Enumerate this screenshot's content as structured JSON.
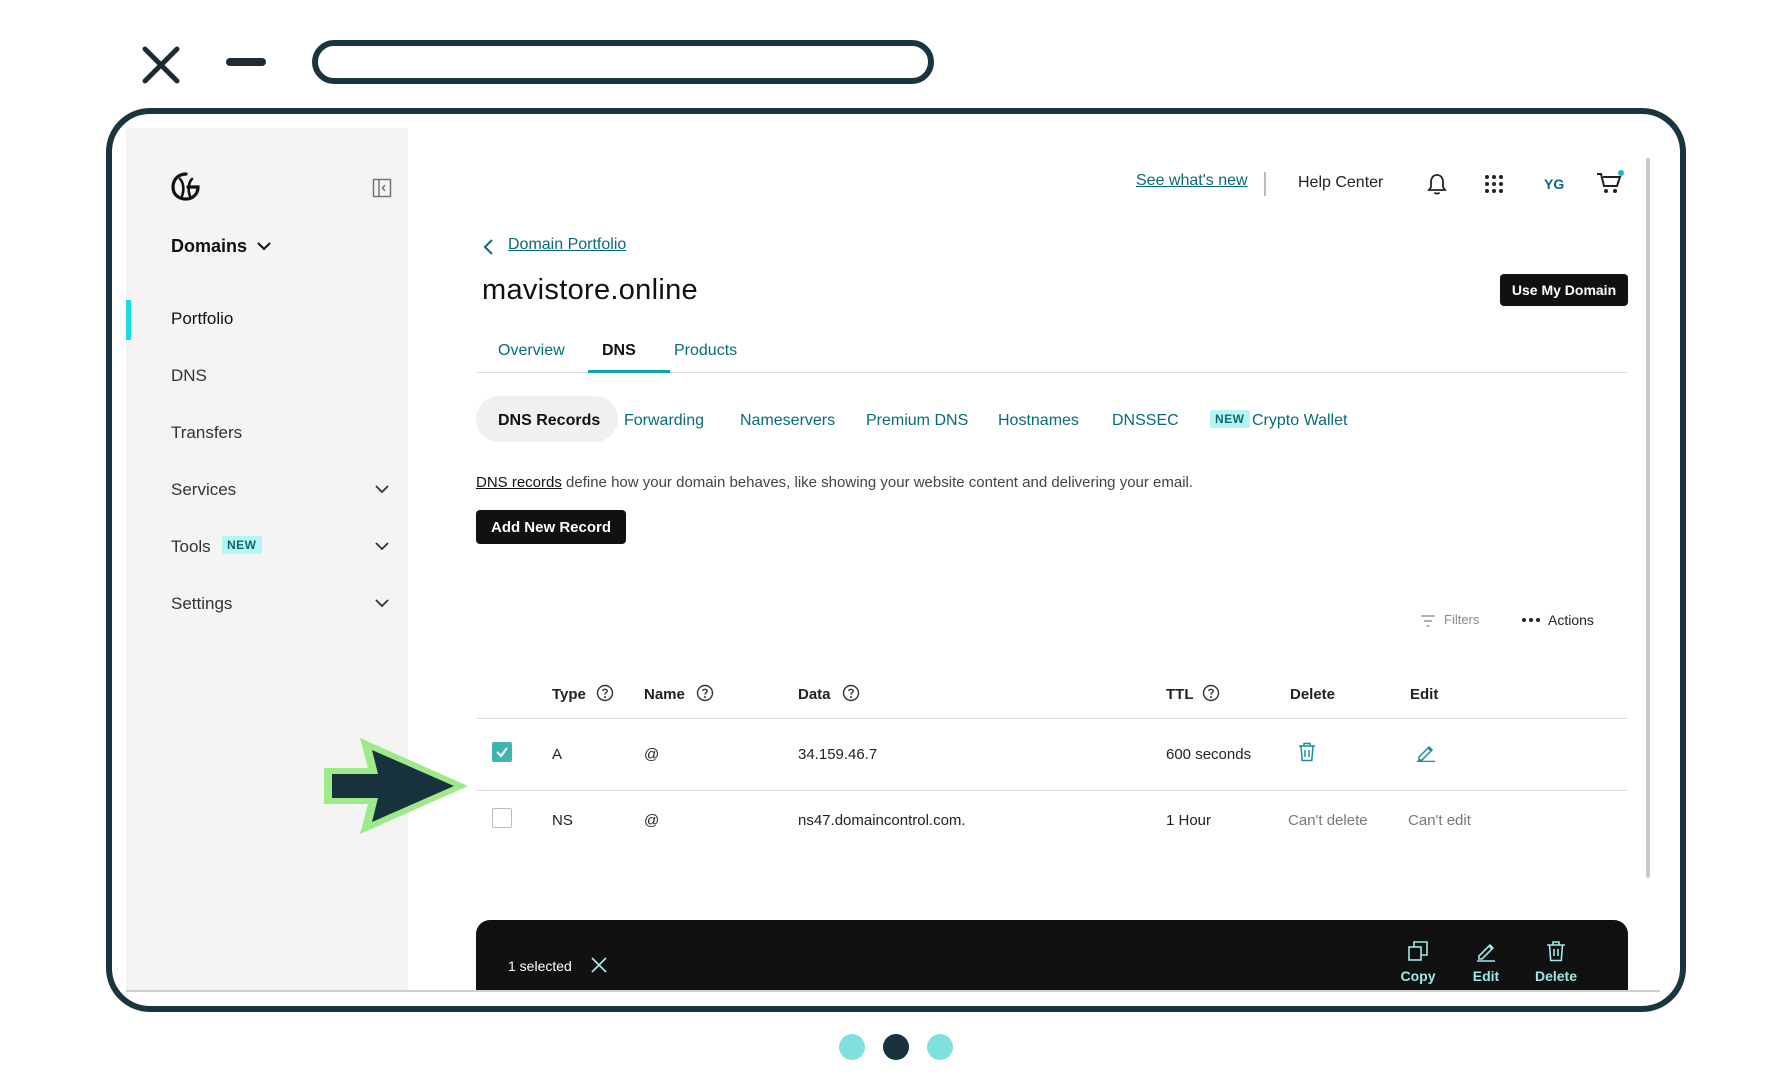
{
  "colors": {
    "accent": "#096b77",
    "teal_bright": "#1bdbdb",
    "dark": "#111111",
    "frame": "#1b3440",
    "arrow_green": "#9ee98a",
    "dot_light": "#7fe0de",
    "dot_dark": "#17323d"
  },
  "icons": [
    "close-icon",
    "minimize-icon",
    "logo-icon",
    "collapse-sidebar-icon",
    "chevron-down-icon",
    "bell-icon",
    "apps-grid-icon",
    "cart-icon",
    "back-chevron-icon",
    "help-circle-icon",
    "filter-icon",
    "more-dots-icon",
    "trash-icon",
    "pencil-icon",
    "copy-icon",
    "arrow-pointer-icon"
  ],
  "sidebar": {
    "domains_label": "Domains",
    "items": [
      {
        "label": "Portfolio"
      },
      {
        "label": "DNS"
      },
      {
        "label": "Transfers"
      },
      {
        "label": "Services"
      },
      {
        "label": "Tools",
        "badge": "NEW"
      },
      {
        "label": "Settings"
      }
    ]
  },
  "header": {
    "see_whats_new": "See what's new",
    "help_center": "Help Center",
    "avatar_initials": "YG"
  },
  "main": {
    "breadcrumb": "Domain Portfolio",
    "title": "mavistore.online",
    "use_domain_button": "Use My Domain",
    "tabs": [
      {
        "label": "Overview"
      },
      {
        "label": "DNS"
      },
      {
        "label": "Products"
      }
    ],
    "subtabs": [
      {
        "label": "DNS Records"
      },
      {
        "label": "Forwarding"
      },
      {
        "label": "Nameservers"
      },
      {
        "label": "Premium DNS"
      },
      {
        "label": "Hostnames"
      },
      {
        "label": "DNSSEC"
      },
      {
        "label": "Crypto Wallet",
        "badge": "NEW"
      }
    ],
    "description_link": "DNS records",
    "description_rest": " define how your domain behaves, like showing your website content and delivering your email.",
    "add_record_button": "Add New Record",
    "filters_label": "Filters",
    "actions_label": "Actions",
    "table": {
      "headers": [
        "Type",
        "Name",
        "Data",
        "TTL",
        "Delete",
        "Edit"
      ],
      "rows": [
        {
          "checked": true,
          "type": "A",
          "name": "@",
          "data": "34.159.46.7",
          "ttl": "600 seconds",
          "delete": "",
          "edit": ""
        },
        {
          "checked": false,
          "type": "NS",
          "name": "@",
          "data": "ns47.domaincontrol.com.",
          "ttl": "1 Hour",
          "delete": "Can't delete",
          "edit": "Can't edit"
        }
      ]
    },
    "bottom_bar": {
      "selected_text": "1 selected",
      "copy": "Copy",
      "edit": "Edit",
      "delete": "Delete"
    }
  }
}
